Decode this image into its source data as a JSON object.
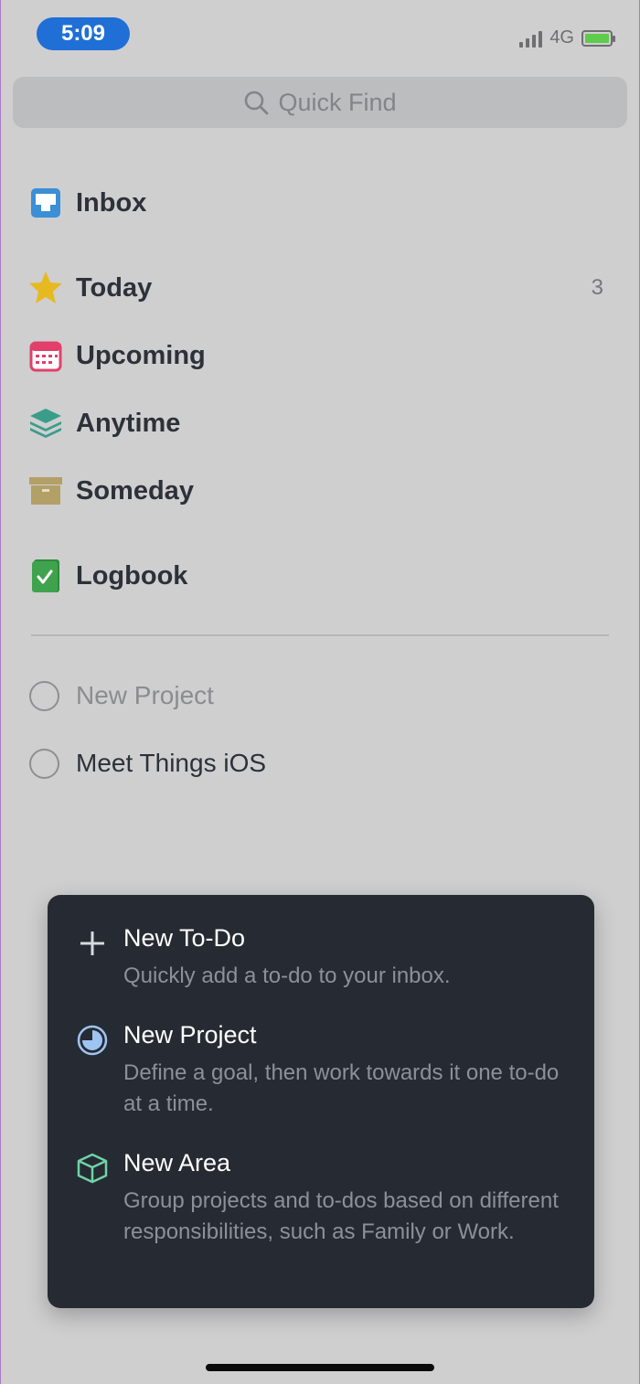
{
  "status": {
    "time": "5:09",
    "network": "4G"
  },
  "search": {
    "placeholder": "Quick Find"
  },
  "nav": [
    {
      "label": "Inbox",
      "icon": "inbox-icon"
    },
    {
      "label": "Today",
      "icon": "star-icon",
      "count": "3"
    },
    {
      "label": "Upcoming",
      "icon": "calendar-icon"
    },
    {
      "label": "Anytime",
      "icon": "layers-icon"
    },
    {
      "label": "Someday",
      "icon": "archive-box-icon"
    },
    {
      "label": "Logbook",
      "icon": "logbook-icon"
    }
  ],
  "projects": [
    {
      "label": "New Project"
    },
    {
      "label": "Meet Things iOS"
    }
  ],
  "menu": {
    "items": [
      {
        "title": "New To-Do",
        "desc": "Quickly add a to-do to your inbox.",
        "icon": "plus-icon"
      },
      {
        "title": "New Project",
        "desc": "Define a goal, then work towards it one to-do at a time.",
        "icon": "project-pie-icon"
      },
      {
        "title": "New Area",
        "desc": "Group projects and to-dos based on different responsibilities, such as Family or Work.",
        "icon": "area-cube-icon"
      }
    ]
  },
  "colors": {
    "background": "#cfcfd0",
    "time_pill": "#1f6fd6",
    "menu_bg": "#262b33",
    "inbox": "#3a8fd6",
    "today": "#e7b921",
    "upcoming": "#e0406a",
    "anytime": "#3a9d8a",
    "someday": "#b3a067",
    "logbook": "#3fa34d",
    "project_accent": "#9ec4f2",
    "area_accent": "#6fd3a7"
  }
}
